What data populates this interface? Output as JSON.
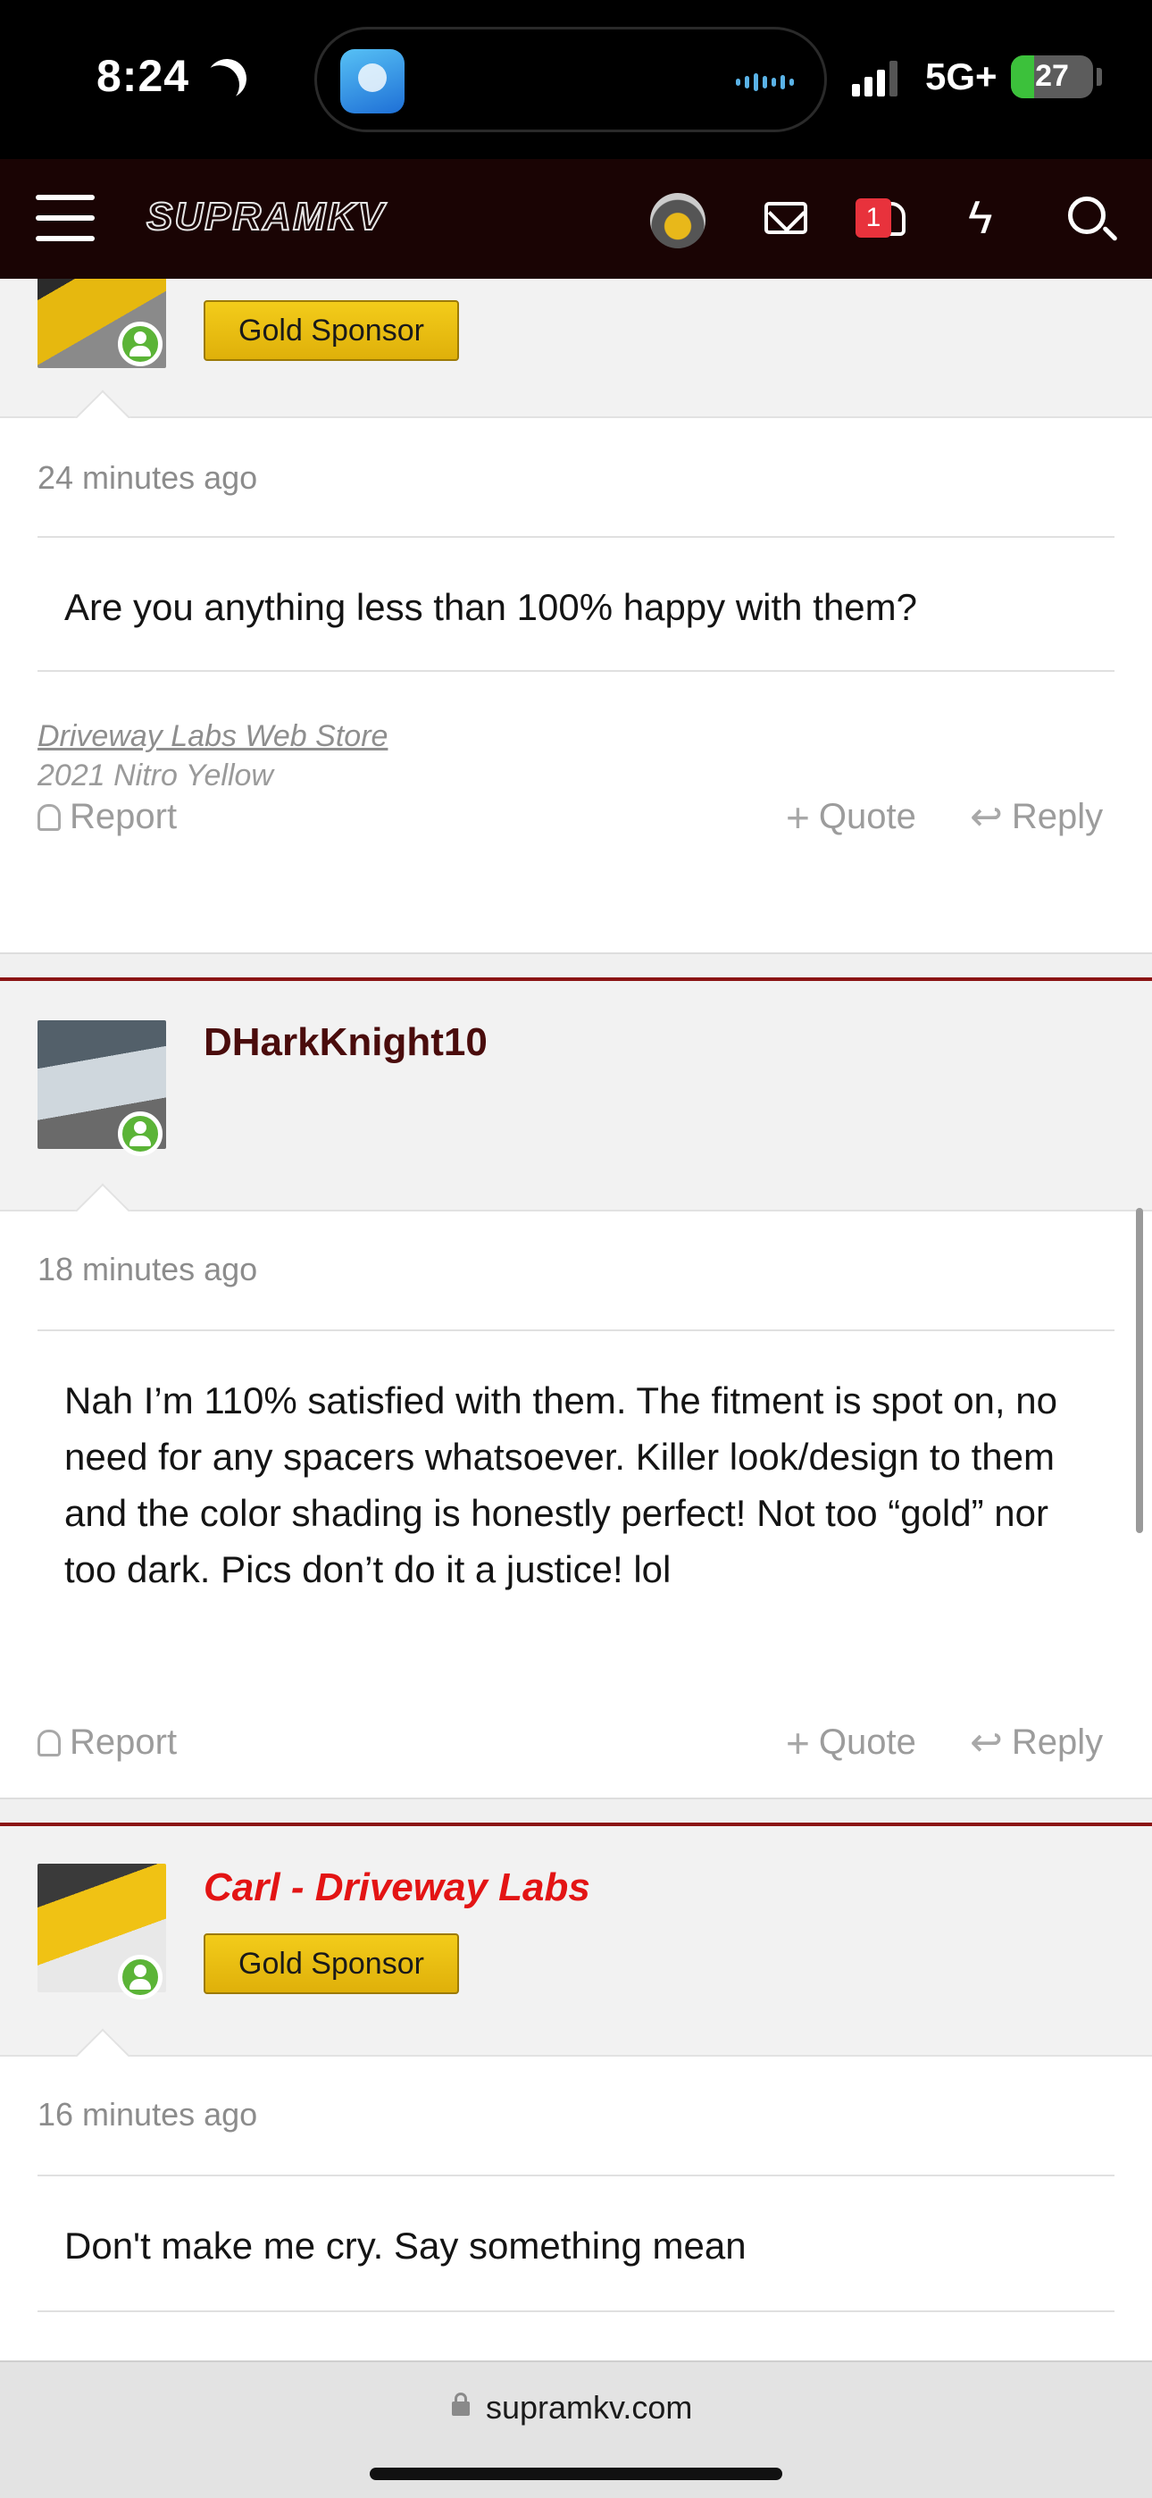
{
  "status_bar": {
    "time": "8:24",
    "network": "5G+",
    "battery": "27"
  },
  "header": {
    "logo": "SUPRAMKV",
    "alert_count": "1"
  },
  "posts": [
    {
      "badge": "Gold Sponsor",
      "time": "24 minutes ago",
      "message": "Are you anything less than 100% happy with them?",
      "signature_link": "Driveway Labs Web Store",
      "signature_line": "2021 Nitro Yellow",
      "actions": {
        "report": "Report",
        "quote": "Quote",
        "reply": "Reply"
      }
    },
    {
      "username": "DHarkKnight10",
      "time": "18 minutes ago",
      "message": "Nah I’m 110% satisfied with them. The fitment is spot on, no need for any spacers whatsoever. Killer look/design to them and the color shading is honestly perfect! Not too “gold” nor too dark. Pics don’t do it a justice! lol",
      "actions": {
        "report": "Report",
        "quote": "Quote",
        "reply": "Reply"
      }
    },
    {
      "username": "Carl - Driveway Labs",
      "badge": "Gold Sponsor",
      "time": "16 minutes ago",
      "message": "Don't make me cry. Say something mean"
    }
  ],
  "browser": {
    "url": "supramkv.com"
  }
}
